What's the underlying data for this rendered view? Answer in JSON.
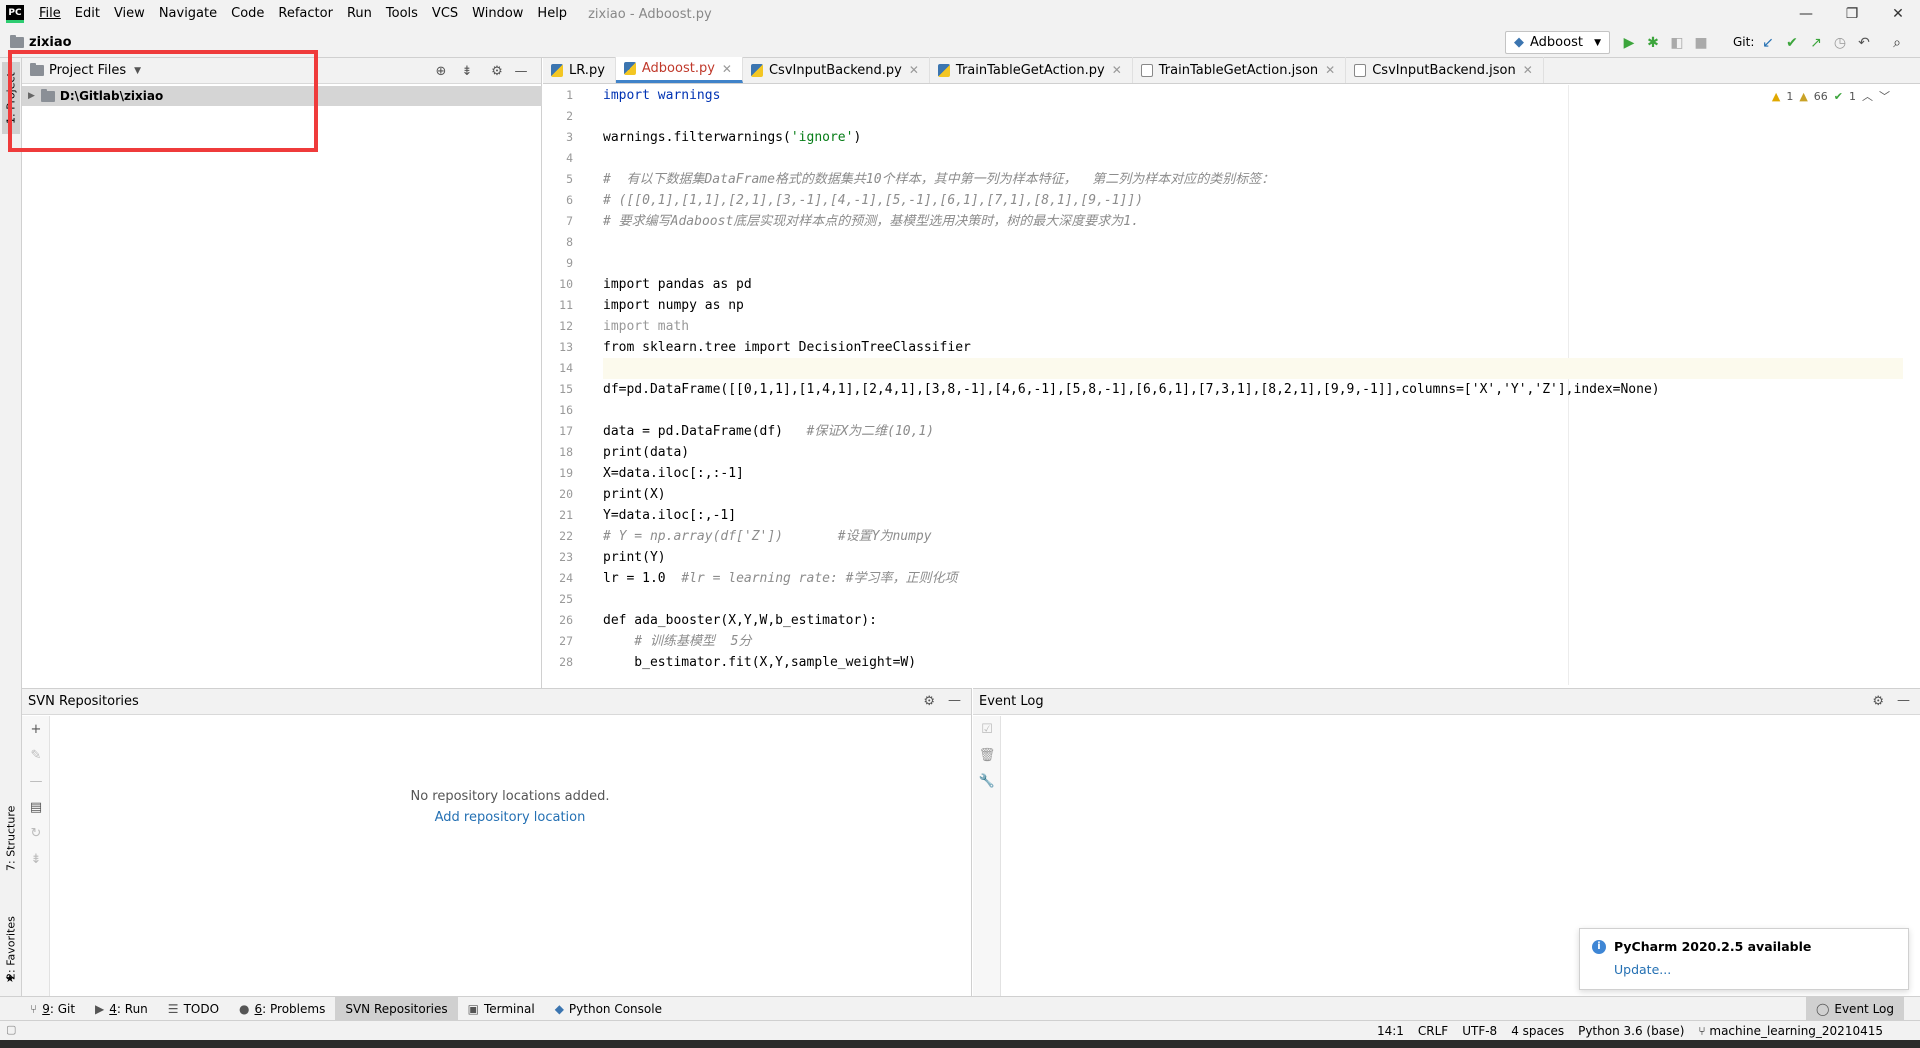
{
  "window": {
    "title": "zixiao - Adboost.py",
    "logo": "PC"
  },
  "menu": [
    "File",
    "Edit",
    "View",
    "Navigate",
    "Code",
    "Refactor",
    "Run",
    "Tools",
    "VCS",
    "Window",
    "Help"
  ],
  "breadcrumb": "zixiao",
  "run_config": "Adboost",
  "git_label": "Git:",
  "project": {
    "header": "Project Files",
    "root": "D:\\Gitlab\\zixiao"
  },
  "left_strip": {
    "project": "1: Project",
    "structure": "7: Structure",
    "favorites": "2: Favorites"
  },
  "tabs": [
    {
      "label": "LR.py",
      "type": "py"
    },
    {
      "label": "Adboost.py",
      "type": "py",
      "active": true
    },
    {
      "label": "CsvInputBackend.py",
      "type": "py"
    },
    {
      "label": "TrainTableGetAction.py",
      "type": "py"
    },
    {
      "label": "TrainTableGetAction.json",
      "type": "json"
    },
    {
      "label": "CsvInputBackend.json",
      "type": "json"
    }
  ],
  "inspections": {
    "warnings": "1",
    "weak_warnings": "66",
    "ok": "1"
  },
  "code_lines": [
    "1",
    "2",
    "3",
    "4",
    "5",
    "6",
    "7",
    "8",
    "9",
    "10",
    "11",
    "12",
    "13",
    "14",
    "15",
    "16",
    "17",
    "18",
    "19",
    "20",
    "21",
    "22",
    "23",
    "24",
    "25",
    "26",
    "27",
    "28"
  ],
  "code": {
    "l1": "import warnings",
    "l3a": "warnings.filterwarnings(",
    "l3b": "'ignore'",
    "l3c": ")",
    "l5": "#  有以下数据集DataFrame格式的数据集共10个样本，其中第一列为样本特征，  第二列为样本对应的类别标签：",
    "l6": "# ([[0,1],[1,1],[2,1],[3,-1],[4,-1],[5,-1],[6,1],[7,1],[8,1],[9,-1]])",
    "l7": "# 要求编写Adaboost底层实现对样本点的预测，基模型选用决策时，树的最大深度要求为1.",
    "l10": "import pandas as pd",
    "l11": "import numpy as np",
    "l12": "import math",
    "l13": "from sklearn.tree import DecisionTreeClassifier",
    "l15": "df=pd.DataFrame([[0,1,1],[1,4,1],[2,4,1],[3,8,-1],[4,6,-1],[5,8,-1],[6,6,1],[7,3,1],[8,2,1],[9,9,-1]],columns=['X','Y','Z'],index=None)",
    "l17a": "data = pd.DataFrame(df)   ",
    "l17b": "#保证X为二维(10,1)",
    "l18": "print(data)",
    "l19": "X=data.iloc[:,:-1]",
    "l20": "print(X)",
    "l21": "Y=data.iloc[:,-1]",
    "l22": "# Y = np.array(df['Z'])       #设置Y为numpy",
    "l23": "print(Y)",
    "l24a": "lr = 1.0  ",
    "l24b": "#lr = learning rate: #学习率，正则化项",
    "l26": "def ada_booster(X,Y,W,b_estimator):",
    "l27": "    # 训练基模型  5分",
    "l28": "    b_estimator.fit(X,Y,sample_weight=W)"
  },
  "svn": {
    "header": "SVN Repositories",
    "empty": "No repository locations added.",
    "link": "Add repository location"
  },
  "eventlog": {
    "header": "Event Log"
  },
  "notification": {
    "title": "PyCharm 2020.2.5 available",
    "link": "Update..."
  },
  "toolwindows": [
    {
      "num": "9",
      "label": "Git",
      "icon": "git-icon"
    },
    {
      "num": "4",
      "label": "Run",
      "icon": "run-icon"
    },
    {
      "num": "",
      "label": "TODO",
      "icon": "todo-icon"
    },
    {
      "num": "6",
      "label": "Problems",
      "icon": "problems-icon"
    },
    {
      "num": "",
      "label": "SVN Repositories",
      "icon": "",
      "active": true
    },
    {
      "num": "",
      "label": "Terminal",
      "icon": "terminal-icon"
    },
    {
      "num": "",
      "label": "Python Console",
      "icon": "python-console-icon"
    }
  ],
  "event_log_button": "Event Log",
  "status": {
    "position": "14:1",
    "line_sep": "CRLF",
    "encoding": "UTF-8",
    "indent": "4 spaces",
    "interpreter": "Python 3.6 (base)",
    "branch": "machine_learning_20210415"
  }
}
